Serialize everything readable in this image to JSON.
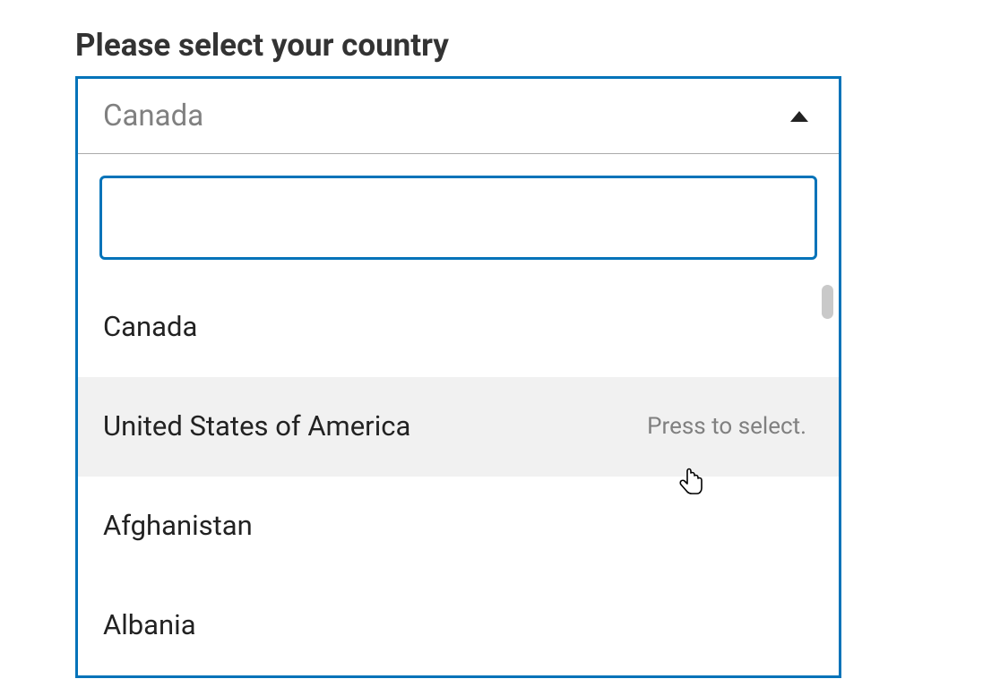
{
  "label": "Please select your country",
  "selected": "Canada",
  "search_value": "",
  "hover_hint": "Press to select.",
  "options": [
    {
      "label": "Canada",
      "hovered": false
    },
    {
      "label": "United States of America",
      "hovered": true
    },
    {
      "label": "Afghanistan",
      "hovered": false
    },
    {
      "label": "Albania",
      "hovered": false
    }
  ],
  "colors": {
    "accent": "#0273b9",
    "text_muted": "#808080"
  }
}
